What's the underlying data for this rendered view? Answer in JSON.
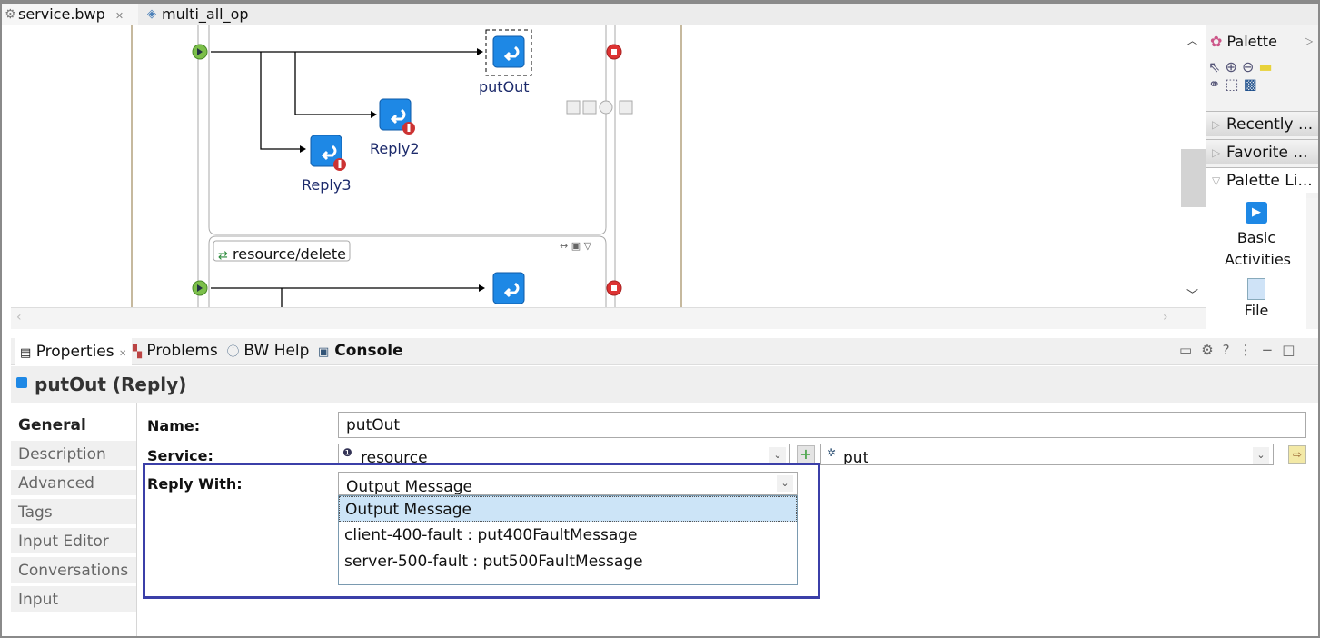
{
  "editor_tabs": [
    {
      "label": "service.bwp",
      "icon": "gear-icon",
      "active": true
    },
    {
      "label": "multi_all_op",
      "icon": "process-icon",
      "active": false
    }
  ],
  "diagram": {
    "activities": [
      {
        "label": "putOut",
        "selected": true
      },
      {
        "label": "Reply2",
        "error": true
      },
      {
        "label": "Reply3",
        "error": true
      }
    ],
    "scope2_label": "resource/delete"
  },
  "palette": {
    "title": "Palette",
    "drawers": [
      "Recently ...",
      "Favorite ...",
      "Palette Li..."
    ],
    "items": [
      "Basic Activities",
      "File"
    ]
  },
  "bottom_tabs": [
    {
      "label": "Properties"
    },
    {
      "label": "Problems"
    },
    {
      "label": "BW Help"
    },
    {
      "label": "Console"
    }
  ],
  "properties": {
    "title": "putOut (Reply)",
    "side_tabs": [
      "General",
      "Description",
      "Advanced",
      "Tags",
      "Input Editor",
      "Conversations",
      "Input"
    ],
    "name_label": "Name:",
    "name_value": "putOut",
    "service_label": "Service:",
    "service_value": "resource",
    "operation_value": "put",
    "reply_label": "Reply With:",
    "reply_value": "Output Message",
    "reply_options": [
      "Output Message",
      "client-400-fault : put400FaultMessage",
      "server-500-fault : put500FaultMessage"
    ]
  },
  "colors": {
    "highlight": "#3b3fa8",
    "activity": "#1e88e5",
    "accent_sel": "#cce4f7"
  }
}
